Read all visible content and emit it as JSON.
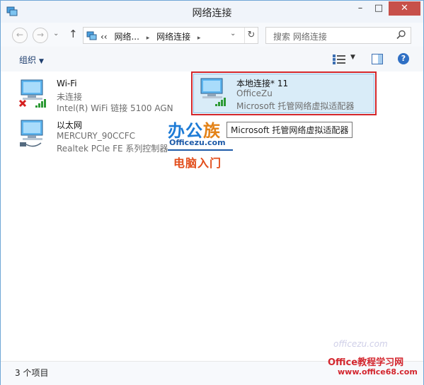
{
  "window": {
    "title": "网络连接",
    "buttons": {
      "minimize": "–",
      "maximize": "□",
      "close": "✕"
    }
  },
  "nav": {
    "back": "←",
    "forward": "→",
    "recent": "⌄",
    "up": "↑",
    "address": {
      "overflow": "‹‹",
      "crumbs": [
        "网络...",
        "网络连接"
      ],
      "separator": "▸",
      "dropdown": "⌄",
      "refresh": "↻"
    },
    "search": {
      "placeholder": "搜索 网络连接"
    }
  },
  "command_bar": {
    "organize_label": "组织",
    "organize_caret": "▼",
    "view_caret": "▼",
    "help": "?"
  },
  "connections": [
    {
      "name": "Wi-Fi",
      "status": "未连接",
      "device": "Intel(R) WiFi 链接 5100 AGN",
      "icon": "wifi-disconnected-icon"
    },
    {
      "name": "以太网",
      "status": "MERCURY_90CCFC",
      "device": "Realtek PCIe FE 系列控制器",
      "icon": "ethernet-icon"
    },
    {
      "name": "本地连接* 11",
      "status": "OfficeZu",
      "device": "Microsoft 托管网络虚拟适配器",
      "icon": "wifi-signal-icon"
    }
  ],
  "tooltip": "Microsoft 托管网络虚拟适配器",
  "watermark": {
    "brand_a": "办公",
    "brand_b": "族",
    "url": "Officezu.com",
    "subtitle": "电脑入门",
    "corner_script": "officezu.com",
    "corner_brand": "Office教程学习网",
    "corner_url": "www.office68.com"
  },
  "status_bar": {
    "text": "3 个项目"
  },
  "colors": {
    "accent": "#2f6fc4",
    "selection": "#d9ecf8",
    "highlight_border": "#d2262b",
    "close": "#c7504a"
  }
}
